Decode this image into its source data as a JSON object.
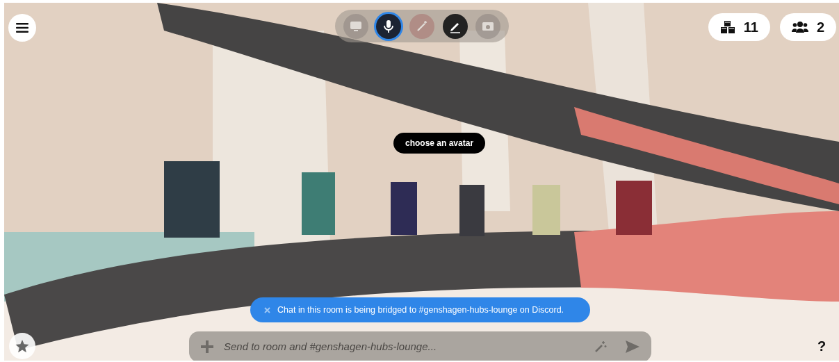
{
  "toolbar": [
    {
      "kind": "screen",
      "active": false,
      "disabled": true
    },
    {
      "kind": "mic",
      "active": true,
      "disabled": false
    },
    {
      "kind": "wand",
      "active": false,
      "disabled": true
    },
    {
      "kind": "pen",
      "active": false,
      "disabled": false
    },
    {
      "kind": "camera",
      "active": false,
      "disabled": true
    }
  ],
  "counters": [
    {
      "kind": "objects",
      "count": "11"
    },
    {
      "kind": "people",
      "count": "2"
    }
  ],
  "scene_label": "choose an avatar",
  "notice": {
    "text": "Chat in this room is being bridged to #genshagen-hubs-lounge on Discord."
  },
  "chat": {
    "placeholder": "Send to room and #genshagen-hubs-lounge..."
  },
  "help": "?"
}
